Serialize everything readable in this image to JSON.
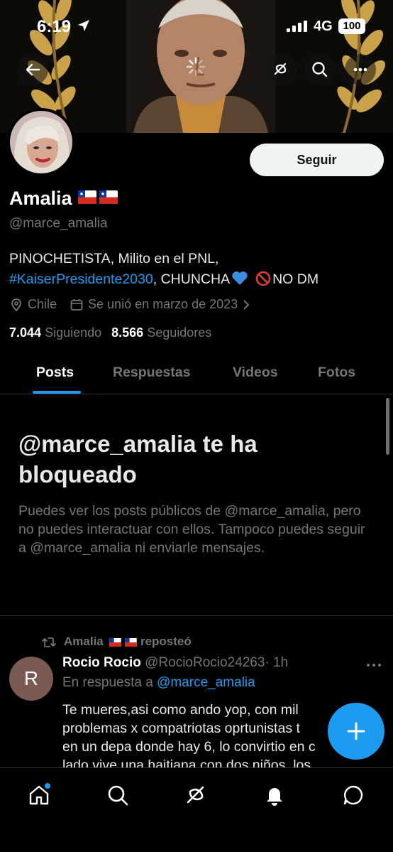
{
  "status_bar": {
    "time": "6:19",
    "network": "4G",
    "battery": "100"
  },
  "profile": {
    "follow_label": "Seguir",
    "name": "Amalia",
    "handle": "@marce_amalia",
    "bio_part1": "PINOCHETISTA, Milito en el PNL,",
    "bio_hashtag": "#KaiserPresidente2030",
    "bio_part2": ", CHUNCHA",
    "bio_part3": "NO DM",
    "location": "Chile",
    "joined": "Se unió en marzo de 2023",
    "following_count": "7.044",
    "following_label": "Siguiendo",
    "followers_count": "8.566",
    "followers_label": "Seguidores"
  },
  "tabs": [
    {
      "label": "Posts"
    },
    {
      "label": "Respuestas"
    },
    {
      "label": "Videos"
    },
    {
      "label": "Fotos"
    }
  ],
  "blocked": {
    "title": "@marce_amalia te ha bloqueado",
    "text": "Puedes ver los posts públicos de @marce_amalia, pero no puedes interactuar con ellos. Tampoco puedes seguir a @marce_amalia ni enviarle mensajes."
  },
  "post": {
    "repost_name": "Amalia",
    "repost_label": "reposteó",
    "avatar_letter": "R",
    "author_name": "Rocio Rocio",
    "author_handle": "@RocioRocio24263",
    "time": "· 1h",
    "reply_prefix": "En respuesta a",
    "reply_mention": "@marce_amalia",
    "body_lines": [
      "Te mueres,asi como ando yop, con mil",
      "problemas x compatriotas oprtunistas t",
      "en un depa donde hay 6, lo convirtio en c",
      "lado vive una haitiana con dos niños, los"
    ]
  },
  "colors": {
    "accent": "#1d9bf0",
    "background": "#000000",
    "muted": "#71767b"
  },
  "icons": [
    "back-arrow-icon",
    "grok-icon",
    "search-icon",
    "more-icon",
    "location-icon",
    "calendar-icon",
    "chevron-right-icon",
    "repost-icon",
    "compose-icon",
    "home-icon",
    "notifications-icon",
    "messages-icon"
  ]
}
